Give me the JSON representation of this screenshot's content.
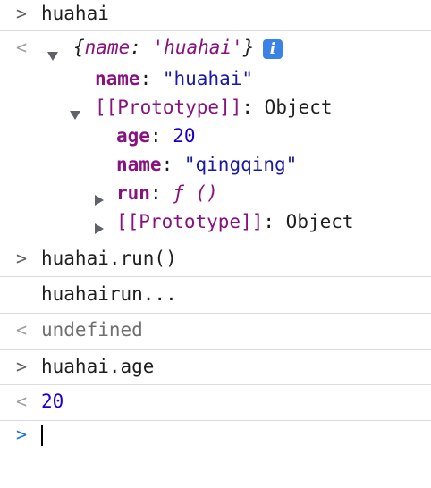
{
  "entries": {
    "input1": {
      "prompt": ">",
      "text": "huahai"
    },
    "output1": {
      "return_marker": "<",
      "summary_open": "{",
      "summary_key": "name",
      "summary_colon": ": ",
      "summary_value": "'huahai'",
      "summary_close": "}",
      "info_icon": "i",
      "props": [
        {
          "key": "name",
          "colon": ": ",
          "value": "\"huahai\""
        }
      ],
      "prototype": {
        "label": "[[Prototype]]",
        "colon": ": ",
        "type": "Object",
        "props": [
          {
            "key": "age",
            "colon": ": ",
            "value": "20"
          },
          {
            "key": "name",
            "colon": ": ",
            "value": "\"qingqing\""
          }
        ],
        "run": {
          "key": "run",
          "colon": ": ",
          "value": "ƒ ()"
        },
        "nested": {
          "label": "[[Prototype]]",
          "colon": ": ",
          "type": "Object"
        }
      }
    },
    "input2": {
      "prompt": ">",
      "text": "huahai.run()"
    },
    "log2": {
      "text": "huahairun..."
    },
    "output2": {
      "return_marker": "<",
      "text": "undefined"
    },
    "input3": {
      "prompt": ">",
      "text": "huahai.age"
    },
    "output3": {
      "return_marker": "<",
      "text": "20"
    },
    "input4": {
      "prompt": ">"
    }
  }
}
